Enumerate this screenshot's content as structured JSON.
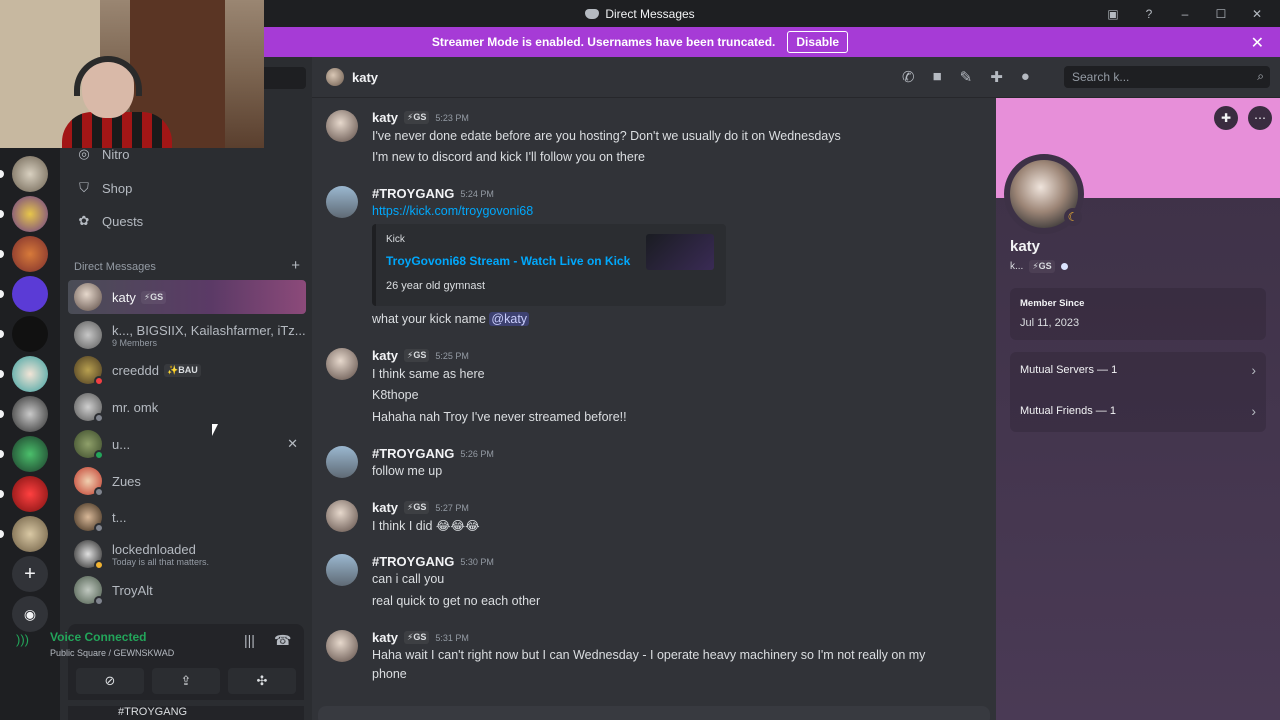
{
  "window": {
    "title": "Direct Messages"
  },
  "streamer_bar": {
    "text": "Streamer Mode is enabled. Usernames have been truncated.",
    "button": "Disable"
  },
  "sidebar": {
    "nav": [
      {
        "label": "Nitro",
        "icon": "nitro-icon"
      },
      {
        "label": "Shop",
        "icon": "shop-icon"
      },
      {
        "label": "Quests",
        "icon": "quests-icon"
      }
    ],
    "dm_header": "Direct Messages",
    "dms": [
      {
        "name": "katy",
        "tag": "⚡GS",
        "sub": "",
        "active": true
      },
      {
        "name": "k..., BIGSIIX, Kailashfarmer, iTz...",
        "tag": "",
        "sub": "9 Members"
      },
      {
        "name": "creeddd",
        "tag": "✨BAU",
        "sub": ""
      },
      {
        "name": "mr. omk",
        "tag": "",
        "sub": ""
      },
      {
        "name": "u...",
        "tag": "",
        "sub": ""
      },
      {
        "name": "Zues",
        "tag": "",
        "sub": ""
      },
      {
        "name": "t...",
        "tag": "",
        "sub": ""
      },
      {
        "name": "lockednloaded",
        "tag": "",
        "sub": "Today is all that matters."
      },
      {
        "name": "TroyAlt",
        "tag": "",
        "sub": ""
      }
    ]
  },
  "voice": {
    "status": "Voice Connected",
    "channel": "Public Square / GEWNSKWAD",
    "bottom_peek": "#TROYGANG"
  },
  "chat_header": {
    "name": "katy",
    "search_placeholder": "Search k..."
  },
  "messages": {
    "m1": {
      "user": "katy",
      "tag": "⚡GS",
      "time": "5:23 PM",
      "lines": [
        "I've never done edate before are you hosting? Don't we usually do it on Wednesdays",
        "I'm new to discord and kick I'll follow you on there"
      ]
    },
    "m2": {
      "user": "#TROYGANG",
      "time": "5:24 PM",
      "link": "https://kick.com/troygovoni68",
      "embed": {
        "provider": "Kick",
        "title": "TroyGovoni68 Stream - Watch Live on Kick",
        "desc": "26 year old gymnast"
      },
      "after": "what your kick name",
      "mention": "@katy"
    },
    "m3": {
      "user": "katy",
      "tag": "⚡GS",
      "time": "5:25 PM",
      "lines": [
        "I think same as here",
        "K8thope",
        "Hahaha nah Troy I've never streamed before!!"
      ]
    },
    "m4": {
      "user": "#TROYGANG",
      "time": "5:26 PM",
      "lines": [
        "follow me up"
      ]
    },
    "m5": {
      "user": "katy",
      "tag": "⚡GS",
      "time": "5:27 PM",
      "lines": [
        "I think I did 😂😂😂"
      ]
    },
    "m6": {
      "user": "#TROYGANG",
      "time": "5:30 PM",
      "lines": [
        "can i call you",
        "real quick to get no each other"
      ]
    },
    "m7": {
      "user": "katy",
      "tag": "⚡GS",
      "time": "5:31 PM",
      "lines": [
        "Haha wait I can't right now but I can Wednesday - I operate heavy machinery so I'm not really on my",
        "phone"
      ]
    }
  },
  "profile": {
    "name": "katy",
    "sub": "k...",
    "tag": "⚡GS",
    "member_since_label": "Member Since",
    "member_since": "Jul 11, 2023",
    "mutual_servers": "Mutual Servers — 1",
    "mutual_friends": "Mutual Friends — 1"
  }
}
